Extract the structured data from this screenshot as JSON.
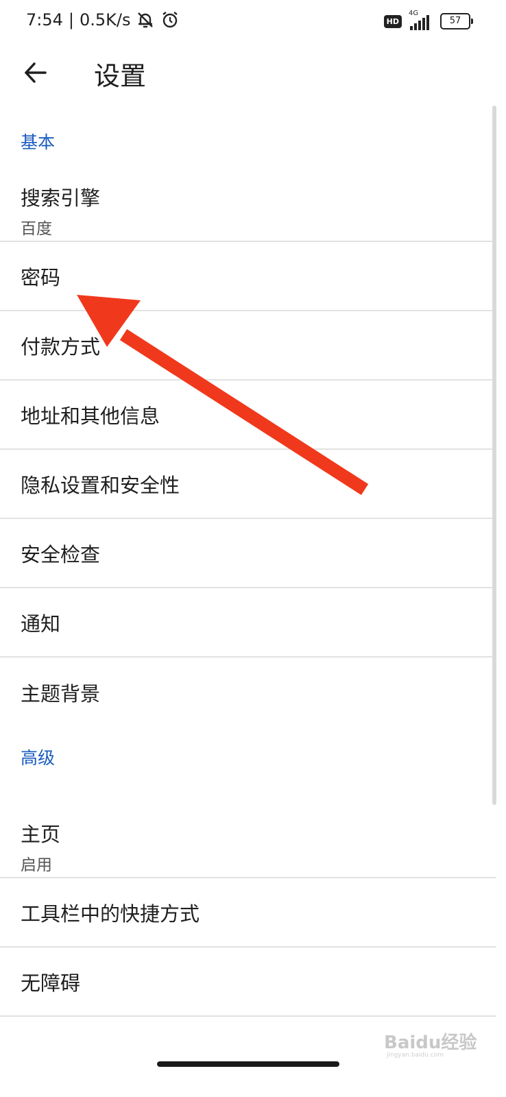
{
  "status_bar": {
    "time": "7:54",
    "separator": "|",
    "speed": "0.5K/s",
    "hd": "HD",
    "network": "4G",
    "battery": "57"
  },
  "app_bar": {
    "title": "设置"
  },
  "sections": {
    "basic": "基本",
    "advanced": "高级"
  },
  "items": {
    "search_engine": {
      "title": "搜索引擎",
      "subtitle": "百度"
    },
    "passwords": {
      "title": "密码"
    },
    "payment": {
      "title": "付款方式"
    },
    "addresses": {
      "title": "地址和其他信息"
    },
    "privacy": {
      "title": "隐私设置和安全性"
    },
    "safety_check": {
      "title": "安全检查"
    },
    "notifications": {
      "title": "通知"
    },
    "theme": {
      "title": "主题背景"
    },
    "homepage": {
      "title": "主页",
      "subtitle": "启用"
    },
    "toolbar_shortcut": {
      "title": "工具栏中的快捷方式"
    },
    "accessibility": {
      "title": "无障碍"
    }
  },
  "watermark": {
    "text": "Baidu经验",
    "sub": "jingyan.baidu.com"
  },
  "colors": {
    "section_header": "#1a5cbf",
    "annotation_arrow": "#f0391c"
  }
}
